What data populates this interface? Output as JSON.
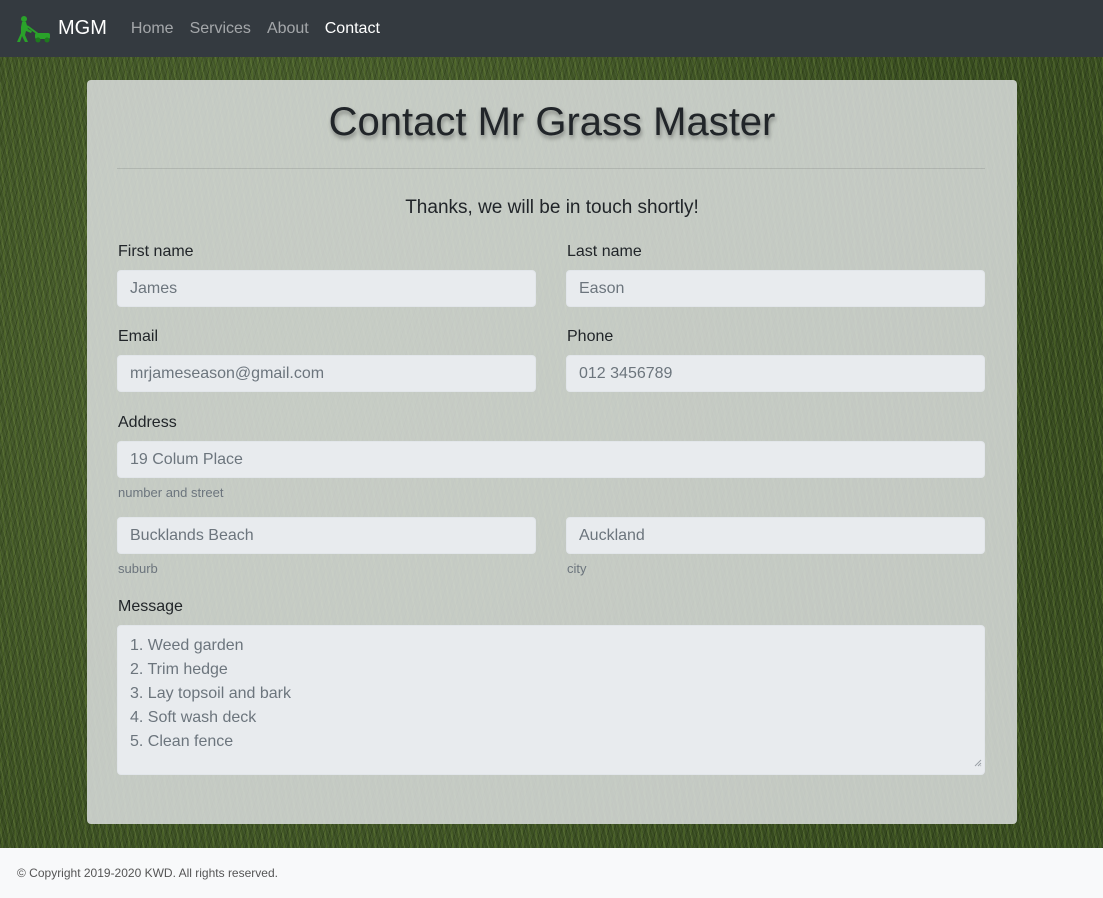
{
  "navbar": {
    "brand": "MGM",
    "logo_icon": "lawnmower-man-icon",
    "brand_color": "#2aa22a",
    "links": [
      {
        "label": "Home",
        "active": false
      },
      {
        "label": "Services",
        "active": false
      },
      {
        "label": "About",
        "active": false
      },
      {
        "label": "Contact",
        "active": true
      }
    ]
  },
  "page": {
    "title": "Contact Mr Grass Master",
    "confirmation": "Thanks, we will be in touch shortly!"
  },
  "form": {
    "first_name": {
      "label": "First name",
      "value": "James"
    },
    "last_name": {
      "label": "Last name",
      "value": "Eason"
    },
    "email": {
      "label": "Email",
      "value": "mrjameseason@gmail.com"
    },
    "phone": {
      "label": "Phone",
      "value": "012 3456789"
    },
    "address": {
      "label": "Address",
      "street": {
        "value": "19 Colum Place",
        "help": "number and street"
      },
      "suburb": {
        "value": "Bucklands Beach",
        "help": "suburb"
      },
      "city": {
        "value": "Auckland",
        "help": "city"
      }
    },
    "message": {
      "label": "Message",
      "lines": [
        "1.  Weed garden",
        "2.  Trim hedge",
        "3.  Lay topsoil and bark",
        "4.  Soft wash deck",
        "5.  Clean fence"
      ]
    }
  },
  "footer": {
    "text": "© Copyright 2019-2020 KWD. All rights reserved."
  }
}
